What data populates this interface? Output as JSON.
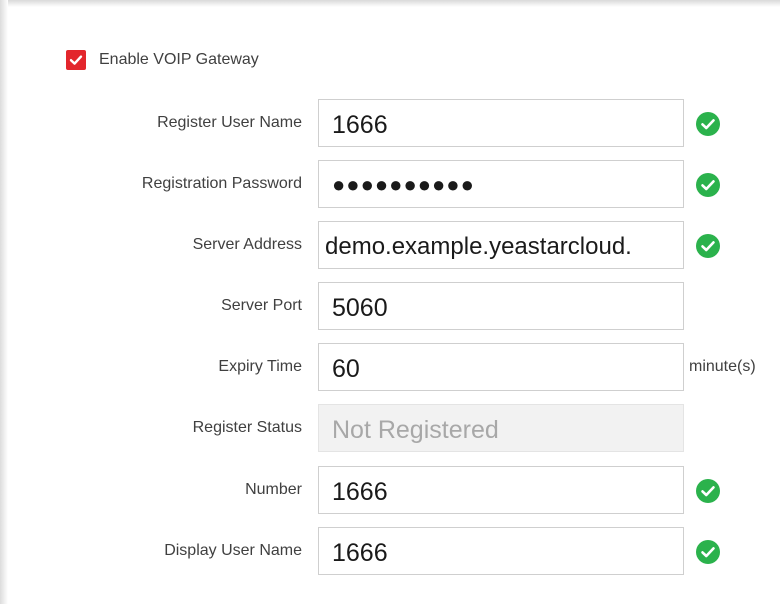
{
  "form": {
    "enable": {
      "label": "Enable VOIP Gateway",
      "checked": true
    },
    "fields": [
      {
        "label": "Register User Name",
        "value": "1666",
        "valid": true
      },
      {
        "label": "Registration Password",
        "value": "●●●●●●●●●●",
        "valid": true
      },
      {
        "label": "Server Address",
        "value": "demo.example.yeastarcloud.",
        "valid": true
      },
      {
        "label": "Server Port",
        "value": "5060"
      },
      {
        "label": "Expiry Time",
        "value": "60",
        "unit": "minute(s)"
      },
      {
        "label": "Register Status",
        "value": "Not Registered",
        "disabled": true
      },
      {
        "label": "Number",
        "value": "1666",
        "valid": true
      },
      {
        "label": "Display User Name",
        "value": "1666",
        "valid": true
      }
    ]
  },
  "colors": {
    "checkbox": "#e3262c",
    "valid_icon": "#2bb24c",
    "label_text": "#404040"
  },
  "icons": {
    "checkbox": "checkmark-icon",
    "valid": "check-circle-icon"
  }
}
